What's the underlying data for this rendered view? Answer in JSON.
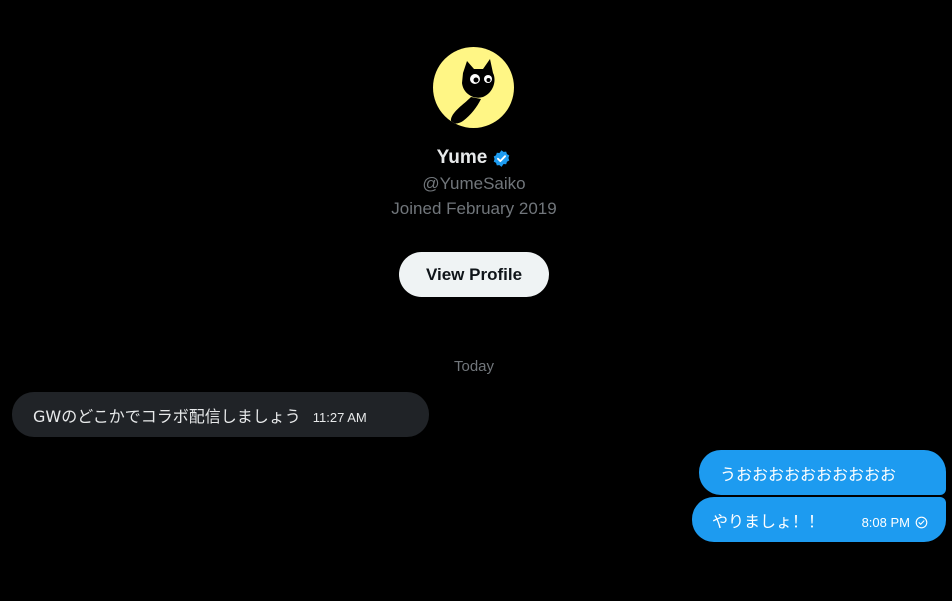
{
  "profile": {
    "name": "Yume",
    "handle": "@YumeSaiko",
    "joined": "Joined February 2019",
    "view_profile_label": "View Profile",
    "avatar_icon": "black-cat-avatar-icon",
    "verified_icon": "verified-badge-icon"
  },
  "conversation": {
    "day_separator": "Today",
    "messages": [
      {
        "direction": "incoming",
        "text": "GWのどこかでコラボ配信しましょう",
        "time": "11:27 AM"
      },
      {
        "direction": "outgoing",
        "text": "うおおおおおおおおおお",
        "time": ""
      },
      {
        "direction": "outgoing",
        "text": "やりましょ！！",
        "time": "8:08 PM",
        "status_icon": "sent-check-icon"
      }
    ]
  },
  "colors": {
    "background": "#000000",
    "outgoing_bubble": "#1d9bf0",
    "incoming_bubble": "#202327",
    "secondary_text": "#71767b",
    "verified": "#1d9bf0",
    "avatar_bg": "#fff685"
  }
}
